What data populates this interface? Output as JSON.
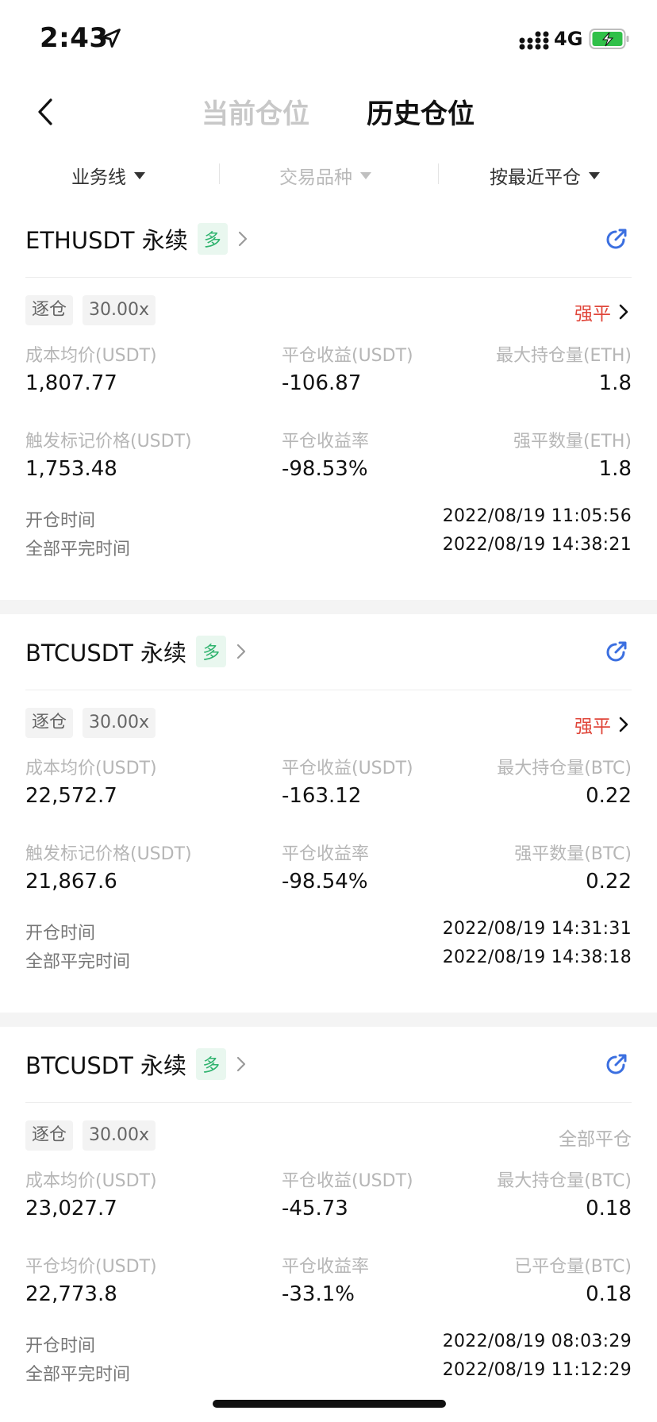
{
  "status": {
    "time": "2:43",
    "network": "4G",
    "colors": {
      "battery": "#30c049"
    }
  },
  "nav": {
    "tabs": [
      "当前仓位",
      "历史仓位"
    ],
    "active_tab": 1
  },
  "filters": [
    {
      "label": "业务线",
      "enabled": true
    },
    {
      "label": "交易品种",
      "enabled": false
    },
    {
      "label": "按最近平仓",
      "enabled": true
    }
  ],
  "positions": [
    {
      "symbol": "ETHUSDT 永续",
      "direction": "多",
      "margin_mode": "逐仓",
      "leverage": "30.00x",
      "close_type": "强平",
      "labels": [
        "成本均价(USDT)",
        "平仓收益(USDT)",
        "最大持仓量(ETH)",
        "触发标记价格(USDT)",
        "平仓收益率",
        "强平数量(ETH)"
      ],
      "values": [
        "1,807.77",
        "-106.87",
        "1.8",
        "1,753.48",
        "-98.53%",
        "1.8"
      ],
      "open_label": "开仓时间",
      "open_time": "2022/08/19 11:05:56",
      "close_label": "全部平完时间",
      "close_time": "2022/08/19 14:38:21"
    },
    {
      "symbol": "BTCUSDT 永续",
      "direction": "多",
      "margin_mode": "逐仓",
      "leverage": "30.00x",
      "close_type": "强平",
      "labels": [
        "成本均价(USDT)",
        "平仓收益(USDT)",
        "最大持仓量(BTC)",
        "触发标记价格(USDT)",
        "平仓收益率",
        "强平数量(BTC)"
      ],
      "values": [
        "22,572.7",
        "-163.12",
        "0.22",
        "21,867.6",
        "-98.54%",
        "0.22"
      ],
      "open_label": "开仓时间",
      "open_time": "2022/08/19 14:31:31",
      "close_label": "全部平完时间",
      "close_time": "2022/08/19 14:38:18"
    },
    {
      "symbol": "BTCUSDT 永续",
      "direction": "多",
      "margin_mode": "逐仓",
      "leverage": "30.00x",
      "close_type": "全部平仓",
      "labels": [
        "成本均价(USDT)",
        "平仓收益(USDT)",
        "最大持仓量(BTC)",
        "平仓均价(USDT)",
        "平仓收益率",
        "已平仓量(BTC)"
      ],
      "values": [
        "23,027.7",
        "-45.73",
        "0.18",
        "22,773.8",
        "-33.1%",
        "0.18"
      ],
      "open_label": "开仓时间",
      "open_time": "2022/08/19 08:03:29",
      "close_label": "全部平完时间",
      "close_time": "2022/08/19 11:12:29"
    }
  ],
  "colors": {
    "liquidation": "#e0463a",
    "long_tag": "#2fb36e",
    "share_icon": "#3b6fe0"
  }
}
